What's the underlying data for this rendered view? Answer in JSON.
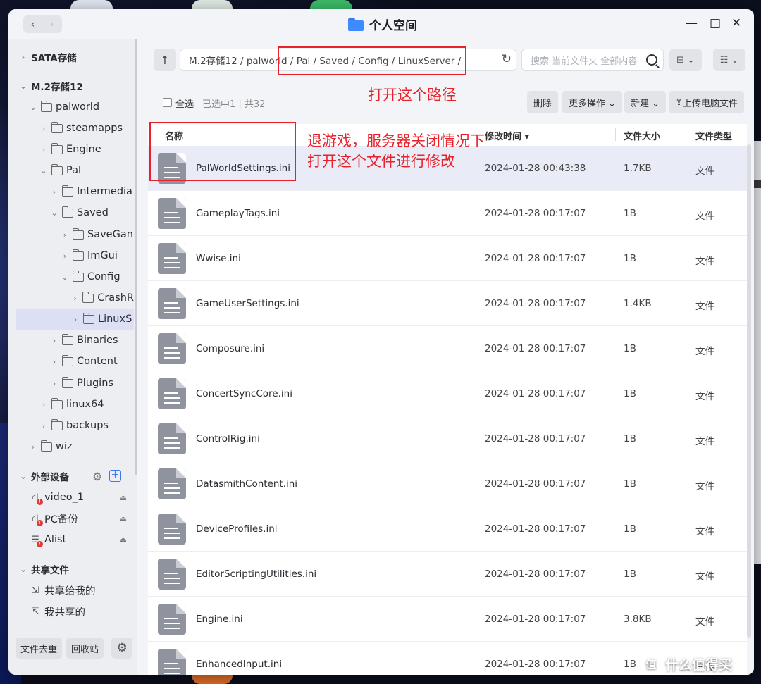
{
  "window": {
    "title": "个人空间"
  },
  "titlebar": {
    "back": "‹",
    "forward": "›",
    "minimize": "—",
    "maximize": "□",
    "close": "✕"
  },
  "sidebar": {
    "tree": [
      {
        "label": "SATA存储",
        "chev": "›",
        "section": true
      },
      {
        "label": "M.2存储12",
        "chev": "⌄",
        "section": true
      },
      {
        "label": "palworld",
        "chev": "⌄"
      },
      {
        "label": "steamapps",
        "chev": "›"
      },
      {
        "label": "Engine",
        "chev": "›"
      },
      {
        "label": "Pal",
        "chev": "⌄"
      },
      {
        "label": "Intermedia",
        "chev": "›"
      },
      {
        "label": "Saved",
        "chev": "⌄"
      },
      {
        "label": "SaveGan",
        "chev": "›"
      },
      {
        "label": "ImGui",
        "chev": "›"
      },
      {
        "label": "Config",
        "chev": "⌄"
      },
      {
        "label": "CrashR",
        "chev": "›"
      },
      {
        "label": "LinuxS",
        "chev": "›"
      },
      {
        "label": "Binaries",
        "chev": "›"
      },
      {
        "label": "Content",
        "chev": "›"
      },
      {
        "label": "Plugins",
        "chev": "›"
      },
      {
        "label": "linux64",
        "chev": "›"
      },
      {
        "label": "backups",
        "chev": "›"
      },
      {
        "label": "wiz",
        "chev": "›"
      }
    ],
    "external_section": "外部设备",
    "external_chev": "⌄",
    "devices": [
      {
        "label": "video_1",
        "icon": "network-drive-icon"
      },
      {
        "label": "PC备份",
        "icon": "network-drive-icon"
      },
      {
        "label": "Alist",
        "icon": "server-icon"
      }
    ],
    "shared_section": "共享文件",
    "shared_chev": "⌄",
    "shared_items": [
      {
        "label": "共享给我的",
        "icon": "share-in-icon"
      },
      {
        "label": "我共享的",
        "icon": "share-out-icon"
      }
    ],
    "bottom": {
      "dedupe": "文件去重",
      "recycle": "回收站"
    }
  },
  "path": {
    "text": "M.2存储12 / palworld / Pal / Saved / Config / LinuxServer /"
  },
  "search": {
    "placeholder": "搜索 当前文件夹 全部内容"
  },
  "toolbar": {
    "select_all": "全选",
    "selection_info": "已选中1 | 共32",
    "delete": "删除",
    "more": "更多操作 ⌄",
    "new": "新建 ⌄",
    "upload": "上传电脑文件"
  },
  "table": {
    "headers": {
      "name": "名称",
      "time": "修改时间 ▾",
      "size": "文件大小",
      "type": "文件类型"
    },
    "rows": [
      {
        "name": "PalWorldSettings.ini",
        "time": "2024-01-28 00:43:38",
        "size": "1.7KB",
        "type": "文件"
      },
      {
        "name": "GameplayTags.ini",
        "time": "2024-01-28 00:17:07",
        "size": "1B",
        "type": "文件"
      },
      {
        "name": "Wwise.ini",
        "time": "2024-01-28 00:17:07",
        "size": "1B",
        "type": "文件"
      },
      {
        "name": "GameUserSettings.ini",
        "time": "2024-01-28 00:17:07",
        "size": "1.4KB",
        "type": "文件"
      },
      {
        "name": "Composure.ini",
        "time": "2024-01-28 00:17:07",
        "size": "1B",
        "type": "文件"
      },
      {
        "name": "ConcertSyncCore.ini",
        "time": "2024-01-28 00:17:07",
        "size": "1B",
        "type": "文件"
      },
      {
        "name": "ControlRig.ini",
        "time": "2024-01-28 00:17:07",
        "size": "1B",
        "type": "文件"
      },
      {
        "name": "DatasmithContent.ini",
        "time": "2024-01-28 00:17:07",
        "size": "1B",
        "type": "文件"
      },
      {
        "name": "DeviceProfiles.ini",
        "time": "2024-01-28 00:17:07",
        "size": "1B",
        "type": "文件"
      },
      {
        "name": "EditorScriptingUtilities.ini",
        "time": "2024-01-28 00:17:07",
        "size": "1B",
        "type": "文件"
      },
      {
        "name": "Engine.ini",
        "time": "2024-01-28 00:17:07",
        "size": "3.8KB",
        "type": "文件"
      },
      {
        "name": "EnhancedInput.ini",
        "time": "2024-01-28 00:17:07",
        "size": "1B",
        "type": "文件"
      }
    ]
  },
  "annotations": {
    "path_note": "打开这个路径",
    "file_note_line1": "退游戏，服务器关闭情况下",
    "file_note_line2": "打开这个文件进行修改",
    "color": "#e8212a"
  },
  "watermark": "什么值得买"
}
